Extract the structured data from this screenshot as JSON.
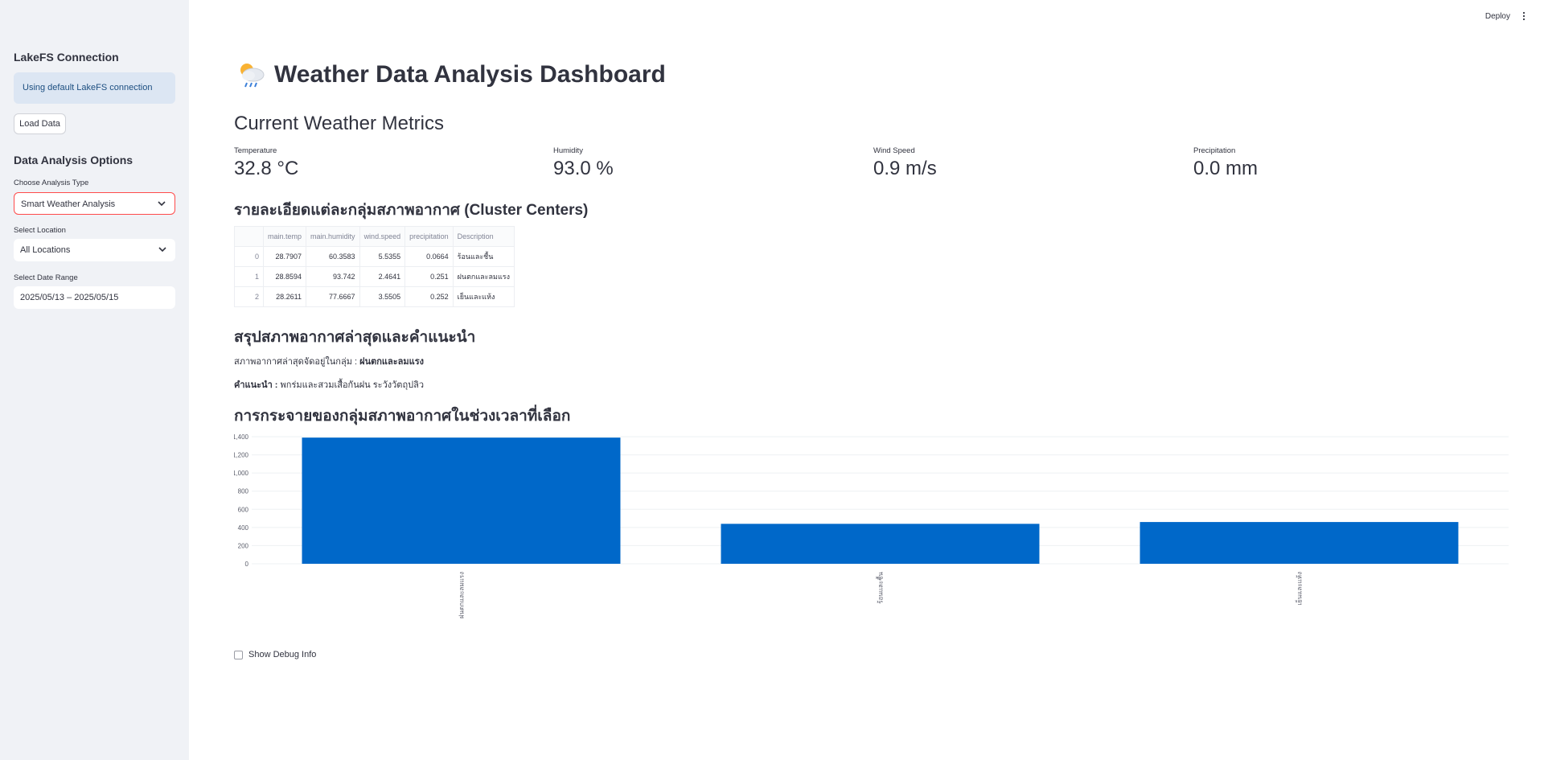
{
  "sidebar": {
    "lakefs_heading": "LakeFS Connection",
    "lakefs_info": "Using default LakeFS connection",
    "load_button": "Load Data",
    "options_heading": "Data Analysis Options",
    "analysis_type": {
      "label": "Choose Analysis Type",
      "value": "Smart Weather Analysis"
    },
    "location": {
      "label": "Select Location",
      "value": "All Locations"
    },
    "date_range": {
      "label": "Select Date Range",
      "value": "2025/05/13 – 2025/05/15"
    }
  },
  "topbar": {
    "deploy": "Deploy",
    "menu_icon": "vertical-dots-icon"
  },
  "main": {
    "title": "Weather Data Analysis Dashboard",
    "title_icon": "cloud-sun-rain-icon",
    "metrics_heading": "Current Weather Metrics",
    "metrics": [
      {
        "label": "Temperature",
        "value": "32.8 °C"
      },
      {
        "label": "Humidity",
        "value": "93.0 %"
      },
      {
        "label": "Wind Speed",
        "value": "0.9 m/s"
      },
      {
        "label": "Precipitation",
        "value": "0.0 mm"
      }
    ],
    "cluster_heading": "รายละเอียดแต่ละกลุ่มสภาพอากาศ (Cluster Centers)",
    "table": {
      "columns": [
        "",
        "main.temp",
        "main.humidity",
        "wind.speed",
        "precipitation",
        "Description"
      ],
      "rows": [
        [
          "0",
          "28.7907",
          "60.3583",
          "5.5355",
          "0.0664",
          "ร้อนและชื้น"
        ],
        [
          "1",
          "28.8594",
          "93.742",
          "2.4641",
          "0.251",
          "ฝนตกและลมแรง"
        ],
        [
          "2",
          "28.2611",
          "77.6667",
          "3.5505",
          "0.252",
          "เย็นและแห้ง"
        ]
      ]
    },
    "summary_heading": "สรุปสภาพอากาศล่าสุดและคำแนะนำ",
    "summary_line1_prefix": "สภาพอากาศล่าสุดจัดอยู่ในกลุ่ม : ",
    "summary_line1_value": "ฝนตกและลมแรง",
    "summary_line2_prefix": "คำแนะนำ : ",
    "summary_line2_value": "พกร่มและสวมเสื้อกันฝน ระวังวัตถุปลิว",
    "distribution_heading": "การกระจายของกลุ่มสภาพอากาศในช่วงเวลาที่เลือก",
    "debug_label": "Show Debug Info"
  },
  "chart_data": {
    "type": "bar",
    "categories": [
      "ฝนตกและลมแรง",
      "ร้อนและชื้น",
      "เย็นและแห้ง"
    ],
    "values": [
      1390,
      440,
      460
    ],
    "ylim": [
      0,
      1400
    ],
    "yticks": [
      0,
      200,
      400,
      600,
      800,
      1000,
      1200,
      1400
    ],
    "ytick_labels": [
      "0",
      "200",
      "400",
      "600",
      "800",
      "1,000",
      "1,200",
      "1,400"
    ],
    "color": "#0068c9",
    "grid": true
  }
}
